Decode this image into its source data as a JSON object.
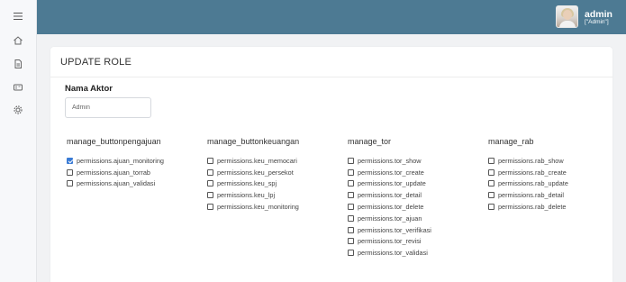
{
  "header": {
    "user_name": "admin",
    "user_role": "[\"Admin\"]",
    "accent_color": "#4d7a93"
  },
  "sidebar": {
    "icons": [
      "menu-icon",
      "home-icon",
      "document-icon",
      "card-icon",
      "gear-icon"
    ]
  },
  "page": {
    "title": "UPDATE ROLE"
  },
  "form": {
    "nama_aktor_label": "Nama Aktor",
    "nama_aktor_value": "Admin"
  },
  "groups": [
    {
      "title": "manage_buttonpengajuan",
      "permissions": [
        {
          "label": "permissions.ajuan_monitoring",
          "checked": true
        },
        {
          "label": "permissions.ajuan_torrab",
          "checked": false
        },
        {
          "label": "permissions.ajuan_validasi",
          "checked": false
        }
      ]
    },
    {
      "title": "manage_buttonkeuangan",
      "permissions": [
        {
          "label": "permissions.keu_memocari",
          "checked": false
        },
        {
          "label": "permissions.keu_persekot",
          "checked": false
        },
        {
          "label": "permissions.keu_spj",
          "checked": false
        },
        {
          "label": "permissions.keu_lpj",
          "checked": false
        },
        {
          "label": "permissions.keu_monitoring",
          "checked": false
        }
      ]
    },
    {
      "title": "manage_tor",
      "permissions": [
        {
          "label": "permissions.tor_show",
          "checked": false
        },
        {
          "label": "permissions.tor_create",
          "checked": false
        },
        {
          "label": "permissions.tor_update",
          "checked": false
        },
        {
          "label": "permissions.tor_detail",
          "checked": false
        },
        {
          "label": "permissions.tor_delete",
          "checked": false
        },
        {
          "label": "permissions.tor_ajuan",
          "checked": false
        },
        {
          "label": "permissions.tor_verifikasi",
          "checked": false
        },
        {
          "label": "permissions.tor_revisi",
          "checked": false
        },
        {
          "label": "permissions.tor_validasi",
          "checked": false
        }
      ]
    },
    {
      "title": "manage_rab",
      "permissions": [
        {
          "label": "permissions.rab_show",
          "checked": false
        },
        {
          "label": "permissions.rab_create",
          "checked": false
        },
        {
          "label": "permissions.rab_update",
          "checked": false
        },
        {
          "label": "permissions.rab_detail",
          "checked": false
        },
        {
          "label": "permissions.rab_delete",
          "checked": false
        }
      ]
    }
  ]
}
